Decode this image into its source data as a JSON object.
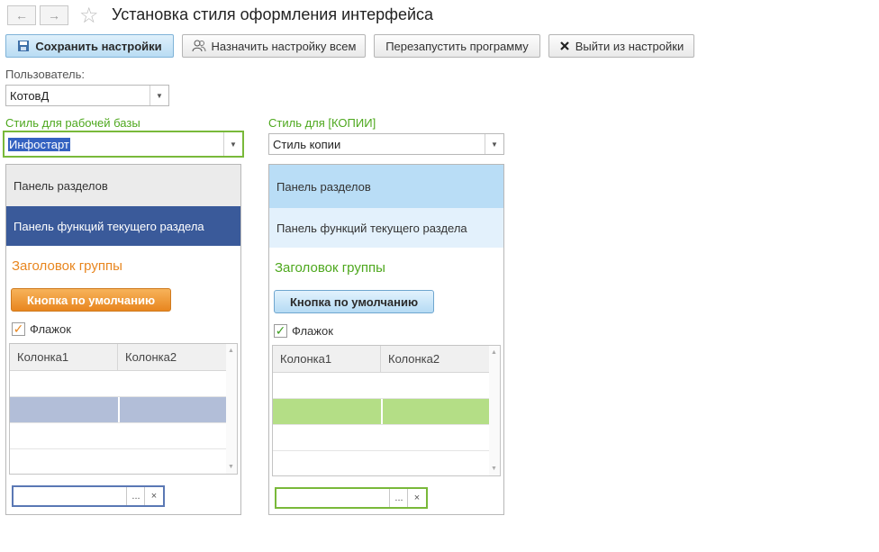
{
  "window": {
    "title": "Установка стиля оформления интерфейса"
  },
  "nav": {
    "back_icon": "←",
    "forward_icon": "→",
    "favorite_icon": "☆"
  },
  "toolbar": {
    "save_label": "Сохранить настройки",
    "assign_all_label": "Назначить настройку всем",
    "restart_label": "Перезапустить программу",
    "exit_label": "Выйти из настройки",
    "icons": {
      "save": "floppy-icon",
      "assign": "users-icon",
      "exit": "close-icon"
    }
  },
  "user": {
    "label": "Пользователь:",
    "value": "КотовД"
  },
  "work_style": {
    "label": "Стиль для рабочей базы",
    "value": "Инфостарт",
    "preview": {
      "sections_panel": "Панель разделов",
      "functions_panel": "Панель функций текущего раздела",
      "group_header": "Заголовок группы",
      "default_button": "Кнопка по умолчанию",
      "checkbox_label": "Флажок",
      "col1": "Колонка1",
      "col2": "Колонка2",
      "input_select": "...",
      "input_clear": "×",
      "colors": {
        "sections_bg": "#ebebeb",
        "functions_bg": "#3a5a9a",
        "accent": "#e8861f",
        "selected_row": "#b2bed8"
      }
    }
  },
  "copy_style": {
    "label": "Стиль для [КОПИИ]",
    "value": "Стиль копии",
    "preview": {
      "sections_panel": "Панель разделов",
      "functions_panel": "Панель функций текущего раздела",
      "group_header": "Заголовок группы",
      "default_button": "Кнопка по умолчанию",
      "checkbox_label": "Флажок",
      "col1": "Колонка1",
      "col2": "Колонка2",
      "input_select": "...",
      "input_clear": "×",
      "colors": {
        "sections_bg": "#b9ddf6",
        "functions_bg": "#e3f1fc",
        "accent": "#4ea81e",
        "selected_row": "#b4de86"
      }
    }
  }
}
